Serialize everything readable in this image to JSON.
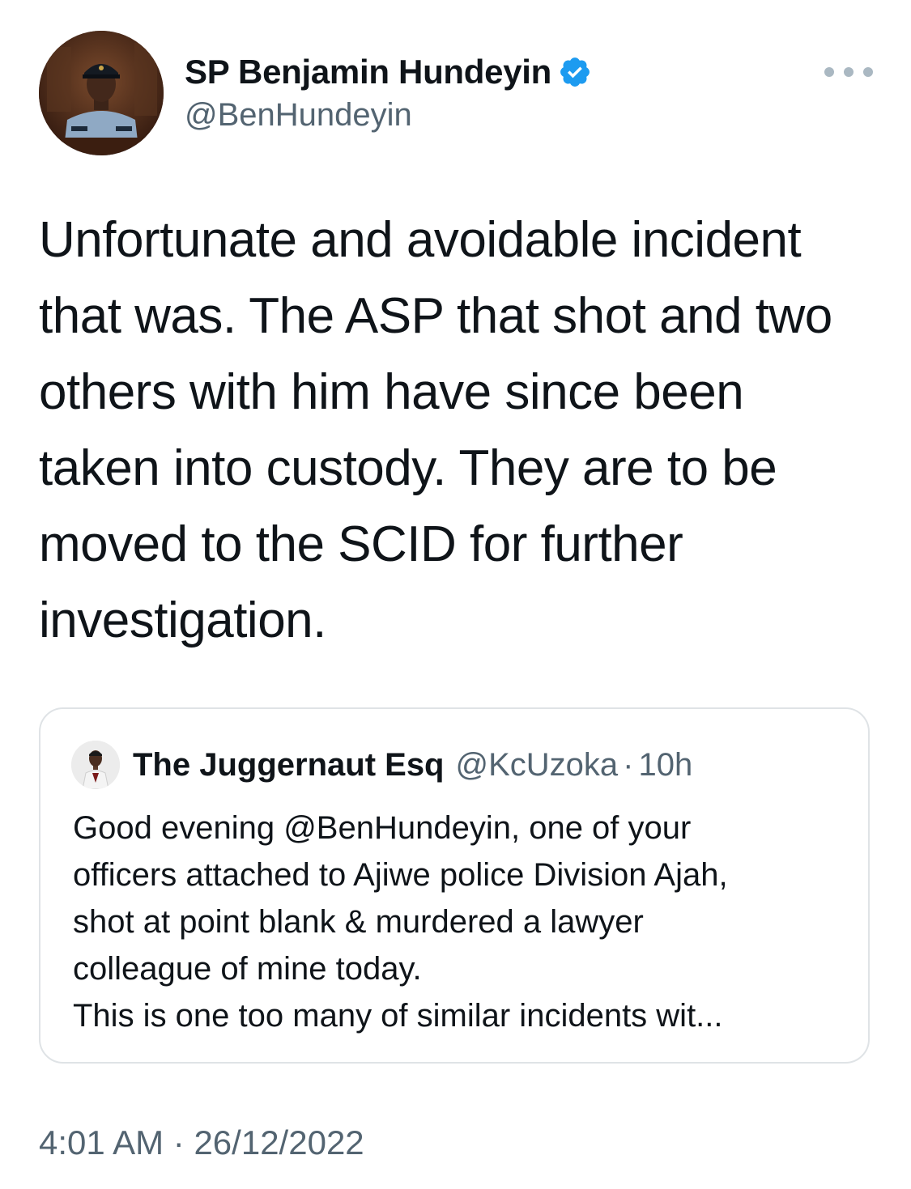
{
  "author": {
    "display_name": "SP Benjamin Hundeyin",
    "handle": "@BenHundeyin",
    "verified": true,
    "avatar_icon": "profile-photo-police-officer"
  },
  "more_icon": "more-options-icon",
  "tweet": {
    "text": "Unfortunate and avoidable incident\nthat was. The ASP that shot and two\nothers with him have since been\ntaken into custody. They are to be\nmoved to the SCID for further\ninvestigation."
  },
  "quoted_tweet": {
    "display_name": "The Juggernaut Esq",
    "handle": "@KcUzoka",
    "separator": "·",
    "time": "10h",
    "text": "Good evening @BenHundeyin, one of your\nofficers attached to Ajiwe police Division Ajah,\nshot at point blank & murdered a lawyer\ncolleague of mine today.\nThis is one too many of similar incidents wit..."
  },
  "footer": {
    "time": "4:01 AM",
    "separator": "·",
    "date": "26/12/2022"
  },
  "colors": {
    "text_primary": "#0f1419",
    "text_secondary": "#536471",
    "verified_blue": "#1d9bf0",
    "card_border": "#dfe3e6"
  }
}
